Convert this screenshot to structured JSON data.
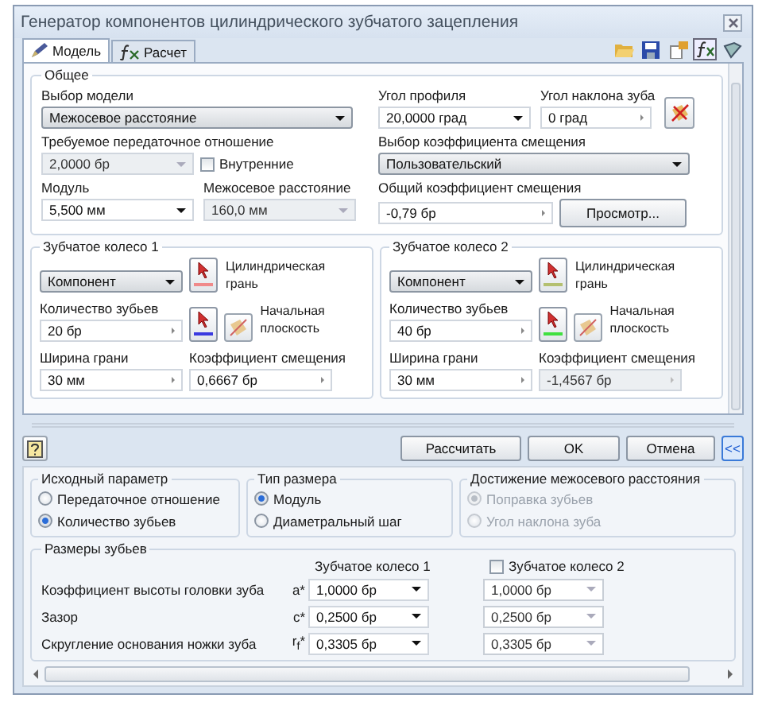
{
  "window": {
    "title": "Генератор компонентов цилиндрического зубчатого зацепления"
  },
  "tabs": [
    {
      "label": "Модель",
      "selected": true
    },
    {
      "label": "Расчет",
      "selected": false
    }
  ],
  "toolbar": [
    {
      "pressed": false
    },
    {
      "pressed": false
    },
    {
      "pressed": false
    },
    {
      "pressed": true
    },
    {
      "pressed": false
    }
  ],
  "general": {
    "legend": "Общее",
    "model": {
      "label": "Выбор модели",
      "field": {
        "value": "Межосевое расстояние",
        "kind": "select",
        "disabled": false
      }
    },
    "profile_angle": {
      "label": "Угол профиля",
      "field": {
        "value": "20,0000 град",
        "kind": "dropdown",
        "disabled": false
      }
    },
    "helix_angle": {
      "label": "Угол наклона зуба",
      "field": {
        "value": "0 град",
        "kind": "spinner",
        "disabled": false
      }
    },
    "ratio": {
      "label": "Требуемое передаточное отношение",
      "field": {
        "value": "2,0000 бр",
        "kind": "dropdown",
        "disabled": true
      }
    },
    "internal": {
      "label": "Внутренние",
      "checked": false
    },
    "shift_choice": {
      "label": "Выбор коэффициента смещения",
      "field": {
        "value": "Пользовательский",
        "kind": "select",
        "disabled": false
      }
    },
    "module": {
      "label": "Модуль",
      "field": {
        "value": "5,500 мм",
        "kind": "dropdown",
        "disabled": false
      }
    },
    "center_distance": {
      "label": "Межосевое расстояние",
      "field": {
        "value": "160,0 мм",
        "kind": "dropdown",
        "disabled": true
      }
    },
    "total_shift": {
      "label": "Общий коэффициент смещения",
      "field": {
        "value": "-0,79 бр",
        "kind": "spinner",
        "disabled": false
      }
    },
    "preview_button": "Просмотр..."
  },
  "gears": [
    {
      "legend": "Зубчатое колесо 1",
      "type": {
        "value": "Компонент",
        "kind": "select",
        "disabled": false
      },
      "face": {
        "label": "Цилиндрическая грань",
        "color": "#f08a8a"
      },
      "plane": {
        "label": "Начальная плоскость",
        "color": "#3a3ae0"
      },
      "teeth": {
        "label": "Количество зубьев",
        "field": {
          "value": "20 бр",
          "kind": "spinner",
          "disabled": false
        }
      },
      "width": {
        "label": "Ширина грани",
        "field": {
          "value": "30 мм",
          "kind": "spinner",
          "disabled": false
        }
      },
      "shift": {
        "label": "Коэффициент смещения",
        "field": {
          "value": "0,6667 бр",
          "kind": "spinner",
          "disabled": false
        }
      }
    },
    {
      "legend": "Зубчатое колесо 2",
      "type": {
        "value": "Компонент",
        "kind": "select",
        "disabled": false
      },
      "face": {
        "label": "Цилиндрическая грань",
        "color": "#b4c070"
      },
      "plane": {
        "label": "Начальная плоскость",
        "color": "#40e040"
      },
      "teeth": {
        "label": "Количество зубьев",
        "field": {
          "value": "40 бр",
          "kind": "spinner",
          "disabled": false
        }
      },
      "width": {
        "label": "Ширина грани",
        "field": {
          "value": "30 мм",
          "kind": "spinner",
          "disabled": false
        }
      },
      "shift": {
        "label": "Коэффициент смещения",
        "field": {
          "value": "-1,4567 бр",
          "kind": "spinner",
          "disabled": true
        }
      }
    }
  ],
  "buttons": {
    "calculate": "Рассчитать",
    "ok": "OK",
    "cancel": "Отмена",
    "collapse": "<<"
  },
  "option_groups": [
    {
      "legend": "Исходный параметр",
      "disabled": false,
      "options": [
        {
          "label": "Передаточное отношение",
          "selected": false
        },
        {
          "label": "Количество зубьев",
          "selected": true
        }
      ]
    },
    {
      "legend": "Тип размера",
      "disabled": false,
      "options": [
        {
          "label": "Модуль",
          "selected": true
        },
        {
          "label": "Диаметральный шаг",
          "selected": false
        }
      ]
    },
    {
      "legend": "Достижение межосевого расстояния",
      "disabled": true,
      "options": [
        {
          "label": "Поправка зубьев",
          "selected": true
        },
        {
          "label": "Угол наклона зуба",
          "selected": false
        }
      ]
    }
  ],
  "tooth_sizes": {
    "legend": "Размеры зубьев",
    "gear1_header": "Зубчатое колесо 1",
    "gear2": {
      "label": "Зубчатое колесо 2",
      "checked": false
    },
    "rows": [
      {
        "label": "Коэффициент высоты головки зуба",
        "symbol": "a*",
        "gear1": "1,0000 бр",
        "gear2": "1,0000 бр"
      },
      {
        "label": "Зазор",
        "symbol": "c*",
        "gear1": "0,2500 бр",
        "gear2": "0,2500 бр"
      },
      {
        "label": "Скругление основания ножки зуба",
        "symbol": "r$_{f}$*",
        "gear1": "0,3305 бр",
        "gear2": "0,3305 бр"
      }
    ]
  }
}
